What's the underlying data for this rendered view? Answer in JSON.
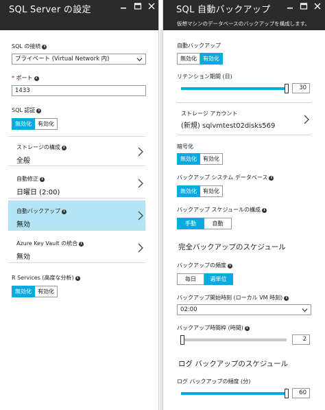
{
  "left": {
    "title": "SQL Server の設定",
    "connection_label": "SQL の接続",
    "connection_value": "プライベート (Virtual Network 内)",
    "port_required": "*",
    "port_label": "ポート",
    "port_value": "1433",
    "auth_label": "SQL 認証",
    "auth_options": [
      "無効化",
      "有効化"
    ],
    "auth_selected": 0,
    "nav": [
      {
        "label": "ストレージの構成",
        "value": "全般"
      },
      {
        "label": "自動修正",
        "value": "日曜日 (2:00)"
      },
      {
        "label": "自動バックアップ",
        "value": "無効"
      },
      {
        "label": "Azure Key Vault の統合",
        "value": "無効"
      }
    ],
    "r_label": "R Services (高度な分析)",
    "r_options": [
      "無効化",
      "有効化"
    ],
    "r_selected": 0
  },
  "right": {
    "title": "SQL 自動バックアップ",
    "subtitle": "仮想マシンのデータベースのバックアップを構成します。",
    "auto_backup_label": "自動バックアップ",
    "auto_backup_options": [
      "無効化",
      "有効化"
    ],
    "auto_backup_selected": 1,
    "retention_label": "リテンション期間 (日)",
    "retention_value": "30",
    "retention_fraction": 1.0,
    "storage_label": "ストレージ アカウント",
    "storage_value": "(新規) sqlvmtest02disks569",
    "encryption_label": "暗号化",
    "encryption_options": [
      "無効化",
      "有効化"
    ],
    "encryption_selected": 0,
    "system_db_label": "バックアップ システム データベース",
    "system_db_options": [
      "無効化",
      "有効化"
    ],
    "system_db_selected": 0,
    "schedule_config_label": "バックアップ スケジュールの構成",
    "schedule_config_options": [
      "手動",
      "自動"
    ],
    "schedule_config_selected": 0,
    "full_backup_section": "完全バックアップのスケジュール",
    "frequency_label": "バックアップの頻度",
    "frequency_options": [
      "毎日",
      "週単位"
    ],
    "frequency_selected": 1,
    "start_time_label": "バックアップ開始時刻 (ローカル VM 時刻)",
    "start_time_value": "02:00",
    "window_label": "バックアップ時間枠 (時間)",
    "window_value": "2",
    "window_fraction": 0.0,
    "log_backup_section": "ログ バックアップのスケジュール",
    "log_frequency_label": "ログ バックアップの頻度 (分)",
    "log_frequency_value": "60",
    "log_frequency_fraction": 1.0
  },
  "icons": {
    "minimize": "minimize-icon",
    "maximize": "maximize-icon",
    "close": "close-icon",
    "info": "info-icon",
    "chevron_right": "chevron-right-icon",
    "chevron_down": "chevron-down-icon"
  },
  "colors": {
    "header_bg": "#2b2b2b",
    "accent": "#0aa9e0",
    "selected_row": "#b3e5f7"
  }
}
